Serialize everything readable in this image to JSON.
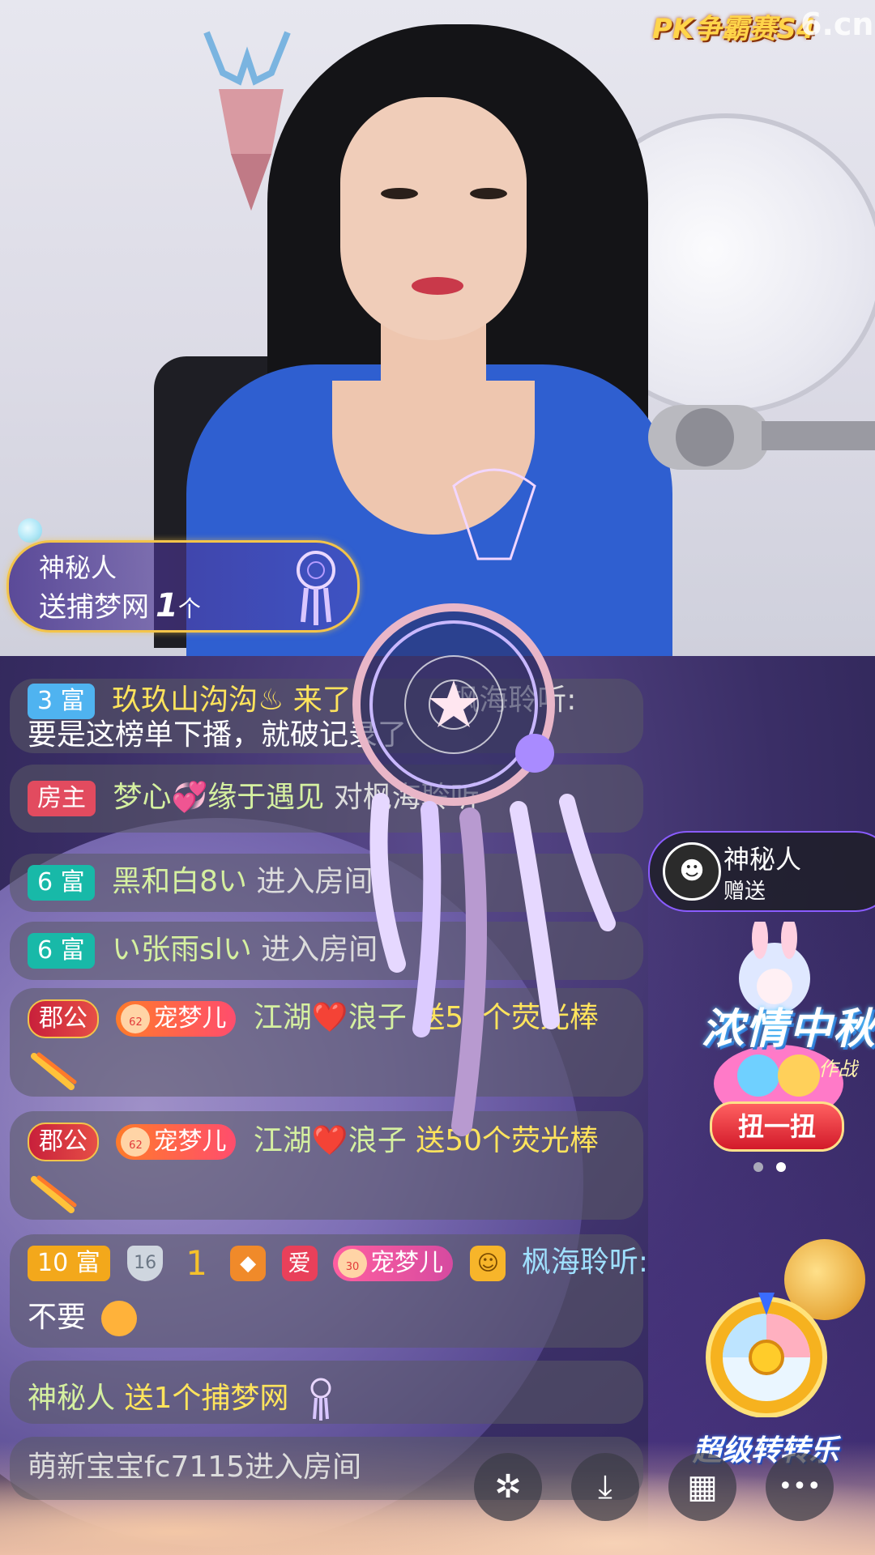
{
  "brand": {
    "event_logo": "PK争霸赛S4",
    "site_logo": "6.cn"
  },
  "gift_toast": {
    "sender": "神秘人",
    "prefix": "送",
    "gift_name": "捕梦网",
    "count": "1",
    "unit": "个"
  },
  "chat": [
    {
      "badge": "3 富",
      "user": "玖玖山沟沟♨ 来了",
      "text": "要是这榜单下播，就破记录了",
      "overlay_tail": "枫海聆听:"
    },
    {
      "badge": "房主",
      "user": "梦心💞缘于遇见",
      "text": "对枫海聆听"
    },
    {
      "badge": "6 富",
      "user": "黑和白8い",
      "text": "进入房间"
    },
    {
      "badge": "6 富",
      "user": "い张雨slい",
      "text": "进入房间"
    },
    {
      "badge": "郡公",
      "pet_badge": "宠梦儿",
      "pet_level": "62",
      "user": "江湖❤️浪子",
      "text": "送50个荧光棒"
    },
    {
      "badge": "郡公",
      "pet_badge": "宠梦儿",
      "pet_level": "62",
      "user": "江湖❤️浪子",
      "text": "送50个荧光棒"
    },
    {
      "badge": "10 富",
      "shield_level": "16",
      "star_level": "1",
      "love": "爱",
      "pet_badge": "宠梦儿",
      "pet_level": "30",
      "user": "枫海聆听:",
      "text": "不要"
    },
    {
      "user": "神秘人",
      "text": "送1个捕梦网"
    },
    {
      "text": "萌新宝宝fc7115进入房间"
    }
  ],
  "gift_notice": {
    "name": "神秘人",
    "action": "赠送"
  },
  "promo": {
    "title": "浓情中秋",
    "subtitle": "作战",
    "button": "扭一扭"
  },
  "wheel": {
    "title": "超级转转乐"
  },
  "toolbar": [
    {
      "icon": "sparkle-icon",
      "glyph": "✲"
    },
    {
      "icon": "download-icon",
      "glyph": "⤓"
    },
    {
      "icon": "grid-icon",
      "glyph": "▦"
    },
    {
      "icon": "more-icon",
      "glyph": "•••"
    }
  ]
}
